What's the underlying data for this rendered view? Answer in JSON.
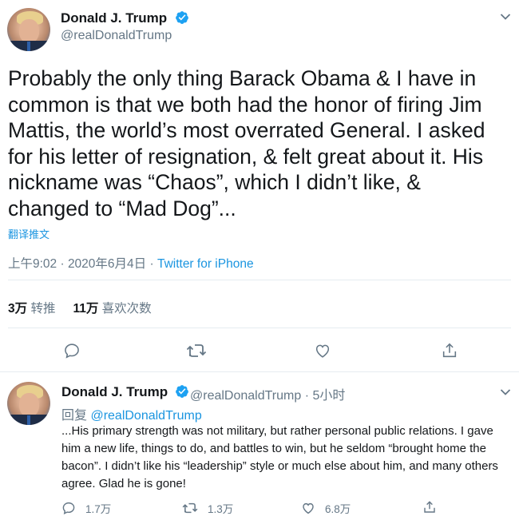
{
  "main_tweet": {
    "author_name": "Donald J. Trump",
    "author_handle": "@realDonaldTrump",
    "text": "Probably the only thing Barack Obama & I have in common is that we both had the honor of firing Jim Mattis, the world’s most overrated General. I asked for his letter of resignation, & felt great about it. His nickname was “Chaos”, which I didn’t like, & changed to “Mad Dog”...",
    "translate_label": "翻译推文",
    "timestamp": "上午9:02 · 2020年6月4日 · ",
    "source": "Twitter for iPhone",
    "retweets_count": "3万",
    "retweets_label": "转推",
    "likes_count": "11万",
    "likes_label": "喜欢次数",
    "icons": [
      "verified-icon",
      "chevron-down-icon",
      "reply-icon",
      "retweet-icon",
      "like-icon",
      "share-icon"
    ]
  },
  "reply_tweet": {
    "author_name": "Donald J. Trump",
    "author_handle": "@realDonaldTrump",
    "time_ago": "· 5小时",
    "replying_to_label": "回复 ",
    "replying_to_handle": "@realDonaldTrump",
    "text": "...His primary strength was not military, but rather personal public relations. I gave him a new life, things to do, and battles to win, but he seldom “brought home the bacon”. I didn’t like his “leadership” style or much else about him, and many others agree. Glad he is gone!",
    "reply_count": "1.7万",
    "retweet_count": "1.3万",
    "like_count": "6.8万"
  },
  "colors": {
    "accent": "#1b95e0",
    "verified": "#1da1f2",
    "text_primary": "#14171a",
    "text_secondary": "#657786",
    "divider": "#e6ecf0"
  }
}
